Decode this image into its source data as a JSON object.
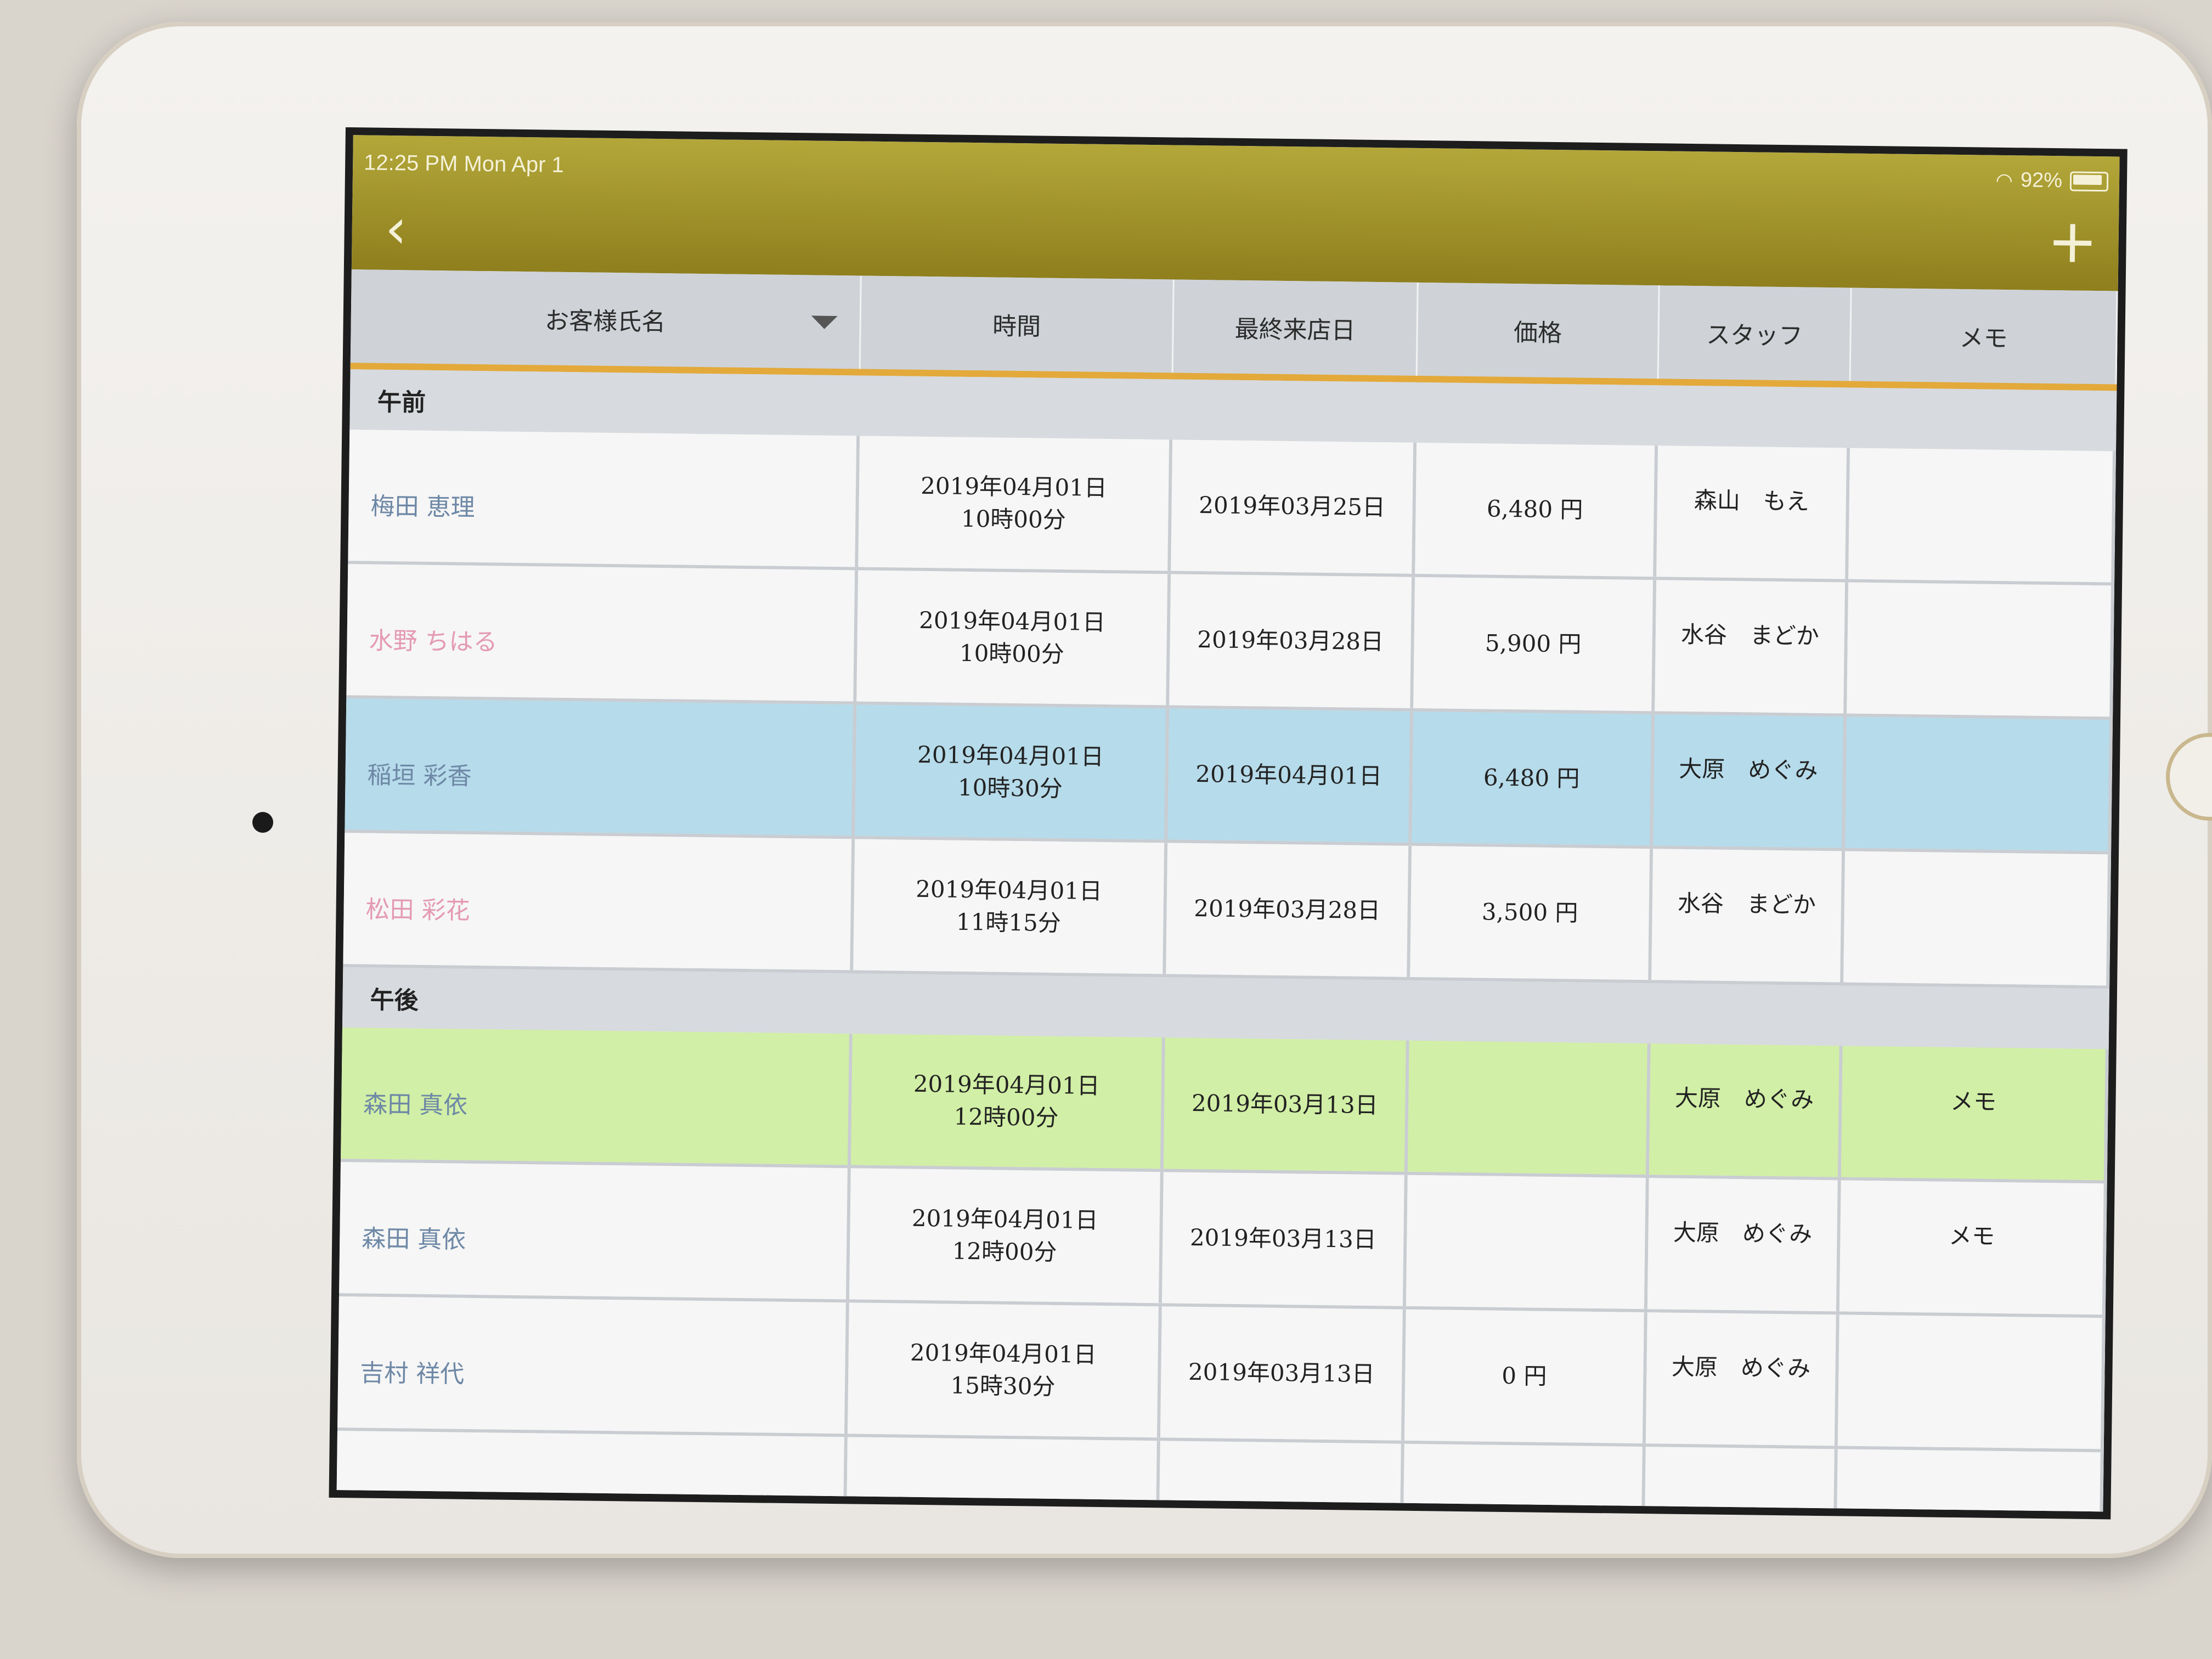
{
  "status_bar": {
    "time": "12:25 PM   Mon Apr 1",
    "battery": "92%"
  },
  "nav": {
    "back_icon": "chevron-left-icon",
    "add_icon": "plus-icon"
  },
  "header": {
    "columns": [
      "お客様氏名",
      "時間",
      "最終来店日",
      "価格",
      "スタッフ",
      "メモ"
    ]
  },
  "sections": [
    {
      "title": "午前"
    },
    {
      "title": "午後"
    }
  ],
  "rows": [
    {
      "name": "梅田 恵理",
      "name_color": "#6e88a6",
      "time": "2019年04月01日\n10時00分",
      "last_visit": "2019年03月25日",
      "price": "6,480 円",
      "staff": "森山　もえ",
      "memo": "",
      "bg": "white"
    },
    {
      "name": "水野 ちはる",
      "name_color": "#e49ab4",
      "time": "2019年04月01日\n10時00分",
      "last_visit": "2019年03月28日",
      "price": "5,900 円",
      "staff": "水谷　まどか",
      "memo": "",
      "bg": "white"
    },
    {
      "name": "稲垣 彩香",
      "name_color": "#6e88a6",
      "time": "2019年04月01日\n10時30分",
      "last_visit": "2019年04月01日",
      "price": "6,480 円",
      "staff": "大原　めぐみ",
      "memo": "",
      "bg": "blue"
    },
    {
      "name": "松田 彩花",
      "name_color": "#e49ab4",
      "time": "2019年04月01日\n11時15分",
      "last_visit": "2019年03月28日",
      "price": "3,500 円",
      "staff": "水谷　まどか",
      "memo": "",
      "bg": "white"
    },
    {
      "name": "森田 真依",
      "name_color": "#6e88a6",
      "time": "2019年04月01日\n12時00分",
      "last_visit": "2019年03月13日",
      "price": "",
      "staff": "大原　めぐみ",
      "memo": "メモ",
      "bg": "green"
    },
    {
      "name": "森田 真依",
      "name_color": "#6e88a6",
      "time": "2019年04月01日\n12時00分",
      "last_visit": "2019年03月13日",
      "price": "",
      "staff": "大原　めぐみ",
      "memo": "メモ",
      "bg": "white"
    },
    {
      "name": "吉村 祥代",
      "name_color": "#6e88a6",
      "time": "2019年04月01日\n15時30分",
      "last_visit": "2019年03月13日",
      "price": "0 円",
      "staff": "大原　めぐみ",
      "memo": "",
      "bg": "white"
    }
  ]
}
